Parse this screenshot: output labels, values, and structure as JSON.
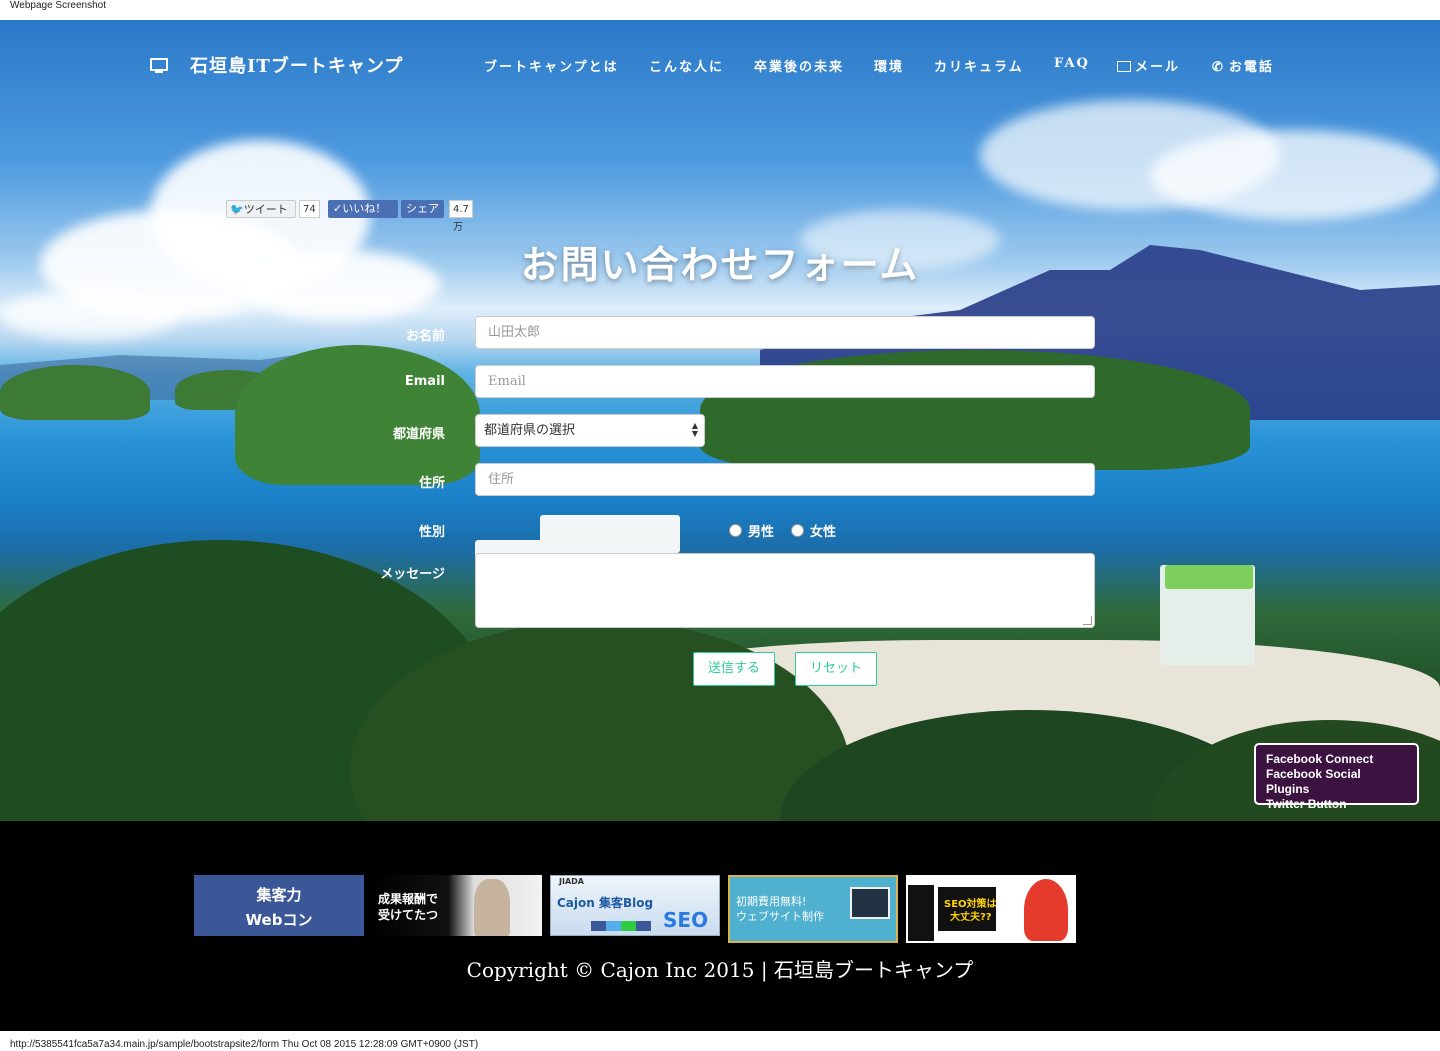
{
  "caption_top": "Webpage Screenshot",
  "caption_bottom": "http://5385541fca5a7a34.main.jp/sample/bootstrapsite2/form Thu Oct 08 2015 12:28:09 GMT+0900 (JST)",
  "brand": {
    "icon": "monitor-icon",
    "title": "石垣島ITブートキャンプ"
  },
  "nav": [
    {
      "label": "ブートキャンプとは"
    },
    {
      "label": "こんな人に"
    },
    {
      "label": "卒業後の未来"
    },
    {
      "label": "環境"
    },
    {
      "label": "カリキュラム"
    },
    {
      "label": "FAQ"
    },
    {
      "label": "メール",
      "icon": "envelope-icon"
    },
    {
      "label": "お電話",
      "icon": "phone-icon"
    }
  ],
  "social": {
    "tweet_label": "ツイート",
    "tweet_count": "74",
    "like_label": "いいね！",
    "share_label": "シェア",
    "share_count": "4.7万"
  },
  "form": {
    "title": "お問い合わせフォーム",
    "name_label": "お名前",
    "name_placeholder": "山田太郎",
    "email_label": "Email",
    "email_placeholder": "Email",
    "pref_label": "都道府県",
    "pref_value": "都道府県の選択",
    "address_label": "住所",
    "address_placeholder": "住所",
    "gender_label": "性別",
    "male": "男性",
    "female": "女性",
    "message_label": "メッセージ",
    "submit": "送信する",
    "reset": "リセット"
  },
  "fb_popup": [
    "Facebook Connect",
    "Facebook Social Plugins",
    "Twitter Button"
  ],
  "banners": {
    "b1_line1": "集客力",
    "b1_line2": "Webコン",
    "b2_line1": "成果報酬で",
    "b2_line2": "受けてたつ",
    "b3_top": "JIADA",
    "b3_text": "Cajon 集客Blog",
    "b3_seo": "SEO",
    "b4_line1": "初期費用無料!",
    "b4_line2": "ウェブサイト制作",
    "b5_text1": "SEO対策は",
    "b5_text2": "大丈夫??"
  },
  "copyright": "Copyright © Cajon Inc 2015 | 石垣島ブートキャンプ",
  "colors": {
    "accent": "#2ecc9a",
    "footer_bg": "#000000",
    "popup_bg": "#3c1240",
    "twitter": "#55acee",
    "facebook": "#4267b2"
  }
}
